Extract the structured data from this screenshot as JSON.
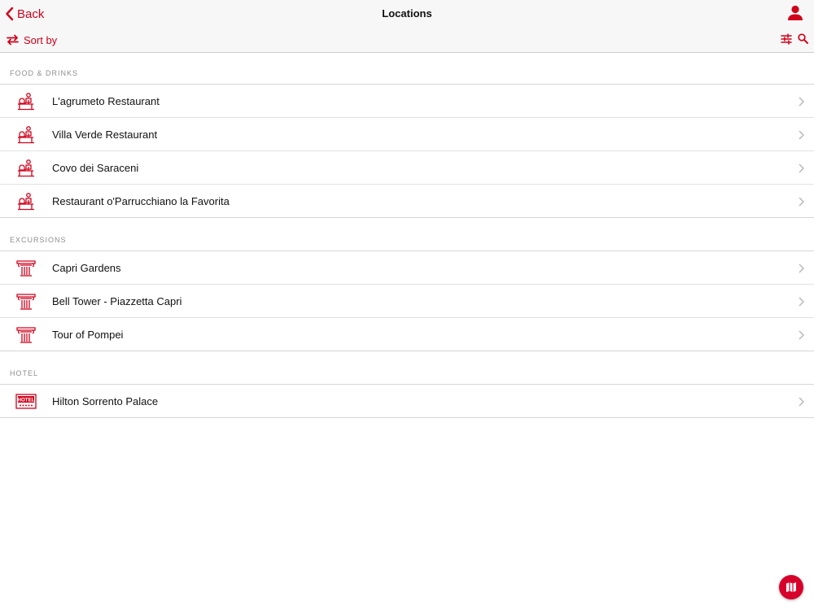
{
  "accent_color": "#d0021b",
  "nav": {
    "back_label": "Back",
    "title": "Locations",
    "sort_label": "Sort by"
  },
  "sections": [
    {
      "header": "FOOD & DRINKS",
      "icon": "restaurant-icon",
      "items": [
        {
          "label": "L'agrumeto Restaurant"
        },
        {
          "label": "Villa Verde Restaurant"
        },
        {
          "label": "Covo dei Saraceni"
        },
        {
          "label": "Restaurant o'Parrucchiano la Favorita"
        }
      ]
    },
    {
      "header": "EXCURSIONS",
      "icon": "column-icon",
      "items": [
        {
          "label": "Capri Gardens"
        },
        {
          "label": "Bell Tower - Piazzetta Capri"
        },
        {
          "label": "Tour of Pompei"
        }
      ]
    },
    {
      "header": "HOTEL",
      "icon": "hotel-icon",
      "icon_text": "HOTEL",
      "items": [
        {
          "label": "Hilton Sorrento Palace"
        }
      ]
    }
  ]
}
